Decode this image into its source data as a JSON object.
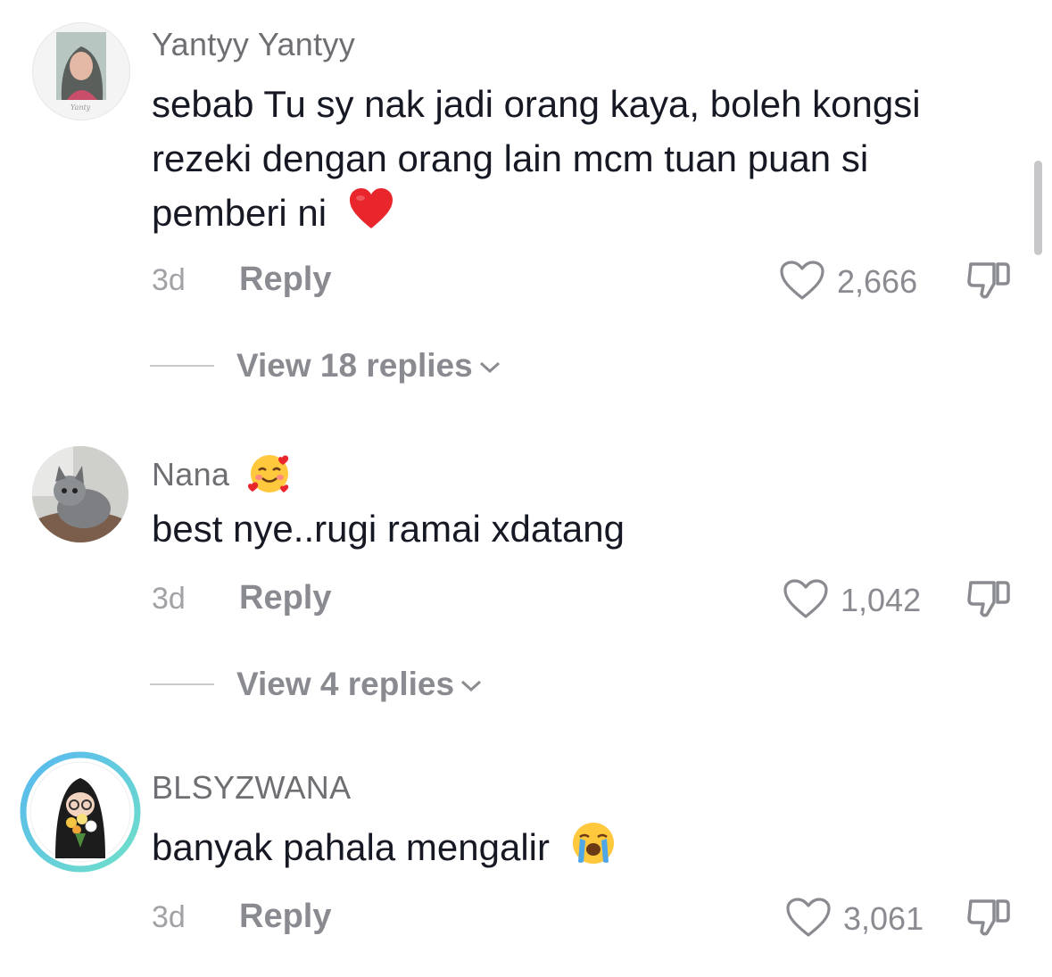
{
  "colors": {
    "username": "#6f6f73",
    "text": "#161823",
    "meta": "#8a8b91",
    "heart": "#e23b3b",
    "ring_a": "#58b8f0",
    "ring_b": "#6fe0c8"
  },
  "comments": [
    {
      "username": "Yantyy Yantyy",
      "lines": [
        "sebab Tu sy nak jadi orang kaya, boleh kongsi",
        "rezeki dengan orang lain mcm tuan puan si",
        "pemberi ni"
      ],
      "emoji": "red-heart",
      "time": "3d",
      "reply_label": "Reply",
      "likes": "2,666",
      "view_replies": "View 18 replies"
    },
    {
      "username": "Nana",
      "username_emoji": "smiling-face-with-hearts",
      "lines": [
        "best nye..rugi ramai xdatang"
      ],
      "time": "3d",
      "reply_label": "Reply",
      "likes": "1,042",
      "view_replies": "View 4 replies"
    },
    {
      "username": "BLSYZWANA",
      "lines": [
        "banyak pahala mengalir"
      ],
      "emoji": "loudly-crying-face",
      "time": "3d",
      "reply_label": "Reply",
      "likes": "3,061"
    }
  ]
}
